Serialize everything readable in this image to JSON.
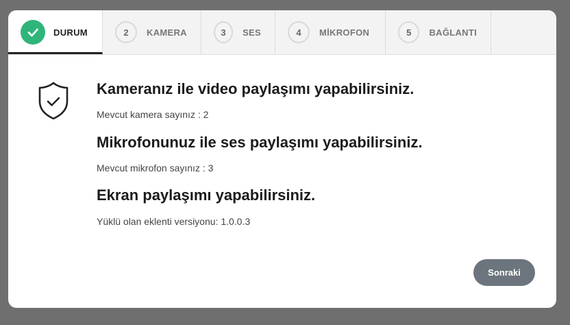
{
  "tabs": [
    {
      "number": "",
      "label": "DURUM",
      "active": true,
      "icon": "check-icon",
      "color": "#2fb57a"
    },
    {
      "number": "2",
      "label": "KAMERA"
    },
    {
      "number": "3",
      "label": "SES"
    },
    {
      "number": "4",
      "label": "MİKROFON"
    },
    {
      "number": "5",
      "label": "BAĞLANTI"
    }
  ],
  "status": {
    "icon": "shield-check-icon",
    "camera_headline": "Kameranız ile video paylaşımı yapabilirsiniz.",
    "camera_count": "Mevcut kamera sayınız : 2",
    "mic_headline": "Mikrofonunuz ile ses paylaşımı yapabilirsiniz.",
    "mic_count": "Mevcut mikrofon sayınız : 3",
    "screen_headline": "Ekran paylaşımı yapabilirsiniz.",
    "extension_version": "Yüklü olan eklenti versiyonu: 1.0.0.3"
  },
  "footer": {
    "next_label": "Sonraki",
    "next_color": "#6c757d"
  }
}
